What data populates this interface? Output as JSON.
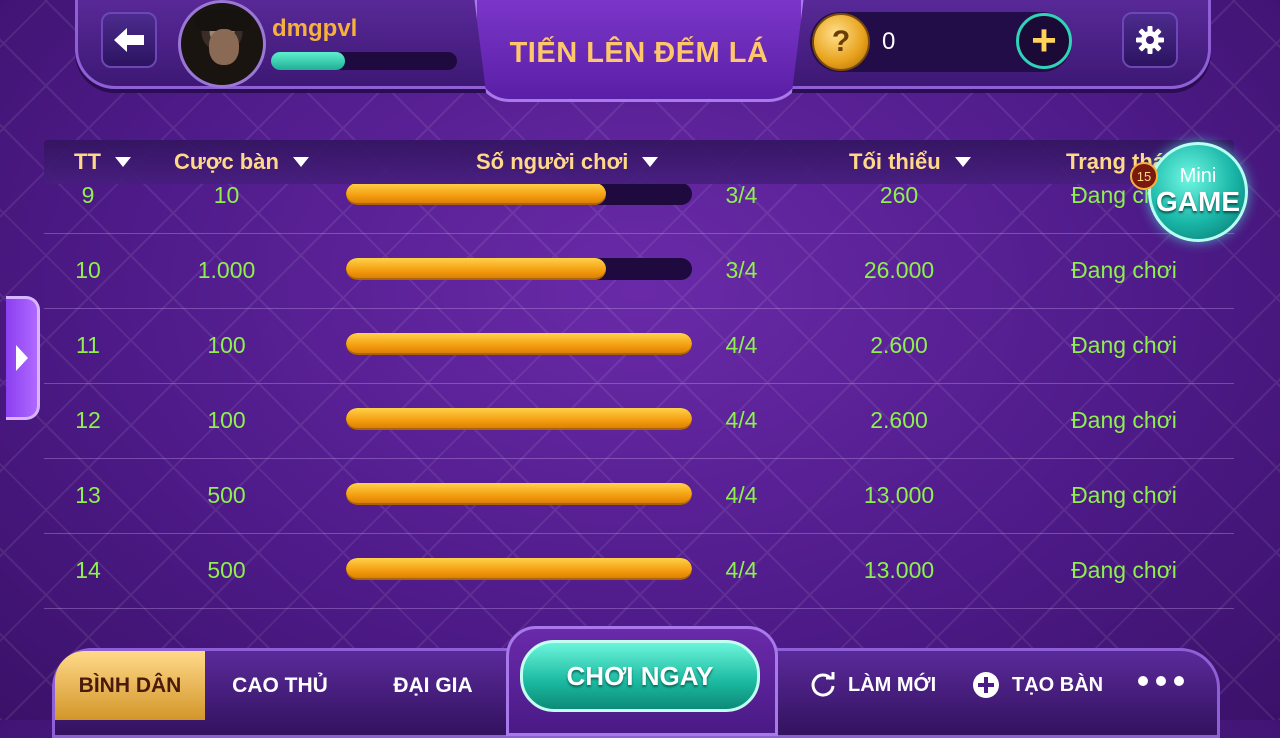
{
  "header": {
    "username": "dmgpvl",
    "xp_progress": 0.4,
    "title": "TIẾN LÊN ĐẾM LÁ",
    "coin_balance": "0",
    "back_icon": "arrow-left-icon",
    "settings_icon": "gear-icon"
  },
  "table": {
    "columns": [
      "TT",
      "Cược bàn",
      "Số người chơi",
      "Tối thiểu",
      "Trạng thái"
    ],
    "rows": [
      {
        "tt": "9",
        "bet": "10",
        "fill": 0.75,
        "players": "3/4",
        "min": "260",
        "status": "Đang chơi"
      },
      {
        "tt": "10",
        "bet": "1.000",
        "fill": 0.75,
        "players": "3/4",
        "min": "26.000",
        "status": "Đang chơi"
      },
      {
        "tt": "11",
        "bet": "100",
        "fill": 1.0,
        "players": "4/4",
        "min": "2.600",
        "status": "Đang chơi"
      },
      {
        "tt": "12",
        "bet": "100",
        "fill": 1.0,
        "players": "4/4",
        "min": "2.600",
        "status": "Đang chơi"
      },
      {
        "tt": "13",
        "bet": "500",
        "fill": 1.0,
        "players": "4/4",
        "min": "13.000",
        "status": "Đang chơi"
      },
      {
        "tt": "14",
        "bet": "500",
        "fill": 1.0,
        "players": "4/4",
        "min": "13.000",
        "status": "Đang chơi"
      }
    ]
  },
  "mini_game": {
    "line1": "Mini",
    "line2": "GAME",
    "badge": "15"
  },
  "footer": {
    "tabs": [
      "BÌNH DÂN",
      "CAO THỦ",
      "ĐẠI GIA"
    ],
    "active_tab": 0,
    "play_now": "CHƠI NGAY",
    "refresh": "LÀM MỚI",
    "create_table": "TẠO BÀN"
  },
  "colors": {
    "accent_green": "#8df04d",
    "gold": "#ffd989",
    "teal": "#1ab89f"
  }
}
